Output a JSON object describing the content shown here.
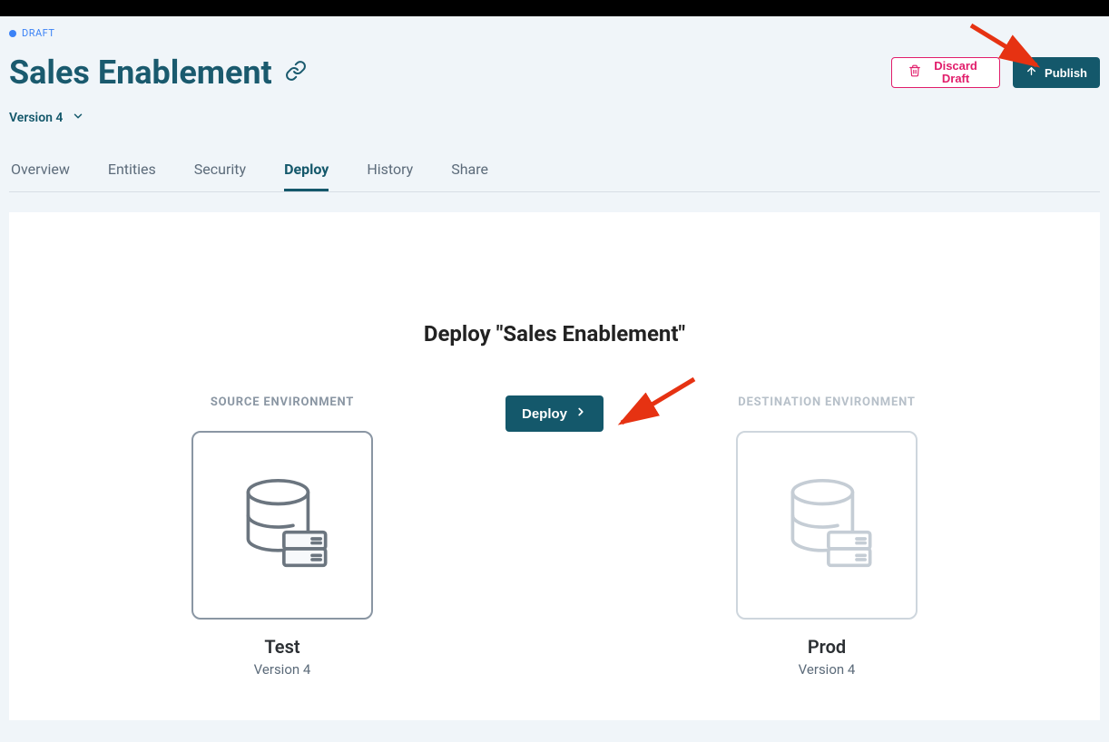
{
  "status": "DRAFT",
  "page_title": "Sales Enablement",
  "version_label": "Version 4",
  "actions": {
    "discard": "Discard Draft",
    "publish": "Publish"
  },
  "tabs": [
    {
      "label": "Overview"
    },
    {
      "label": "Entities"
    },
    {
      "label": "Security"
    },
    {
      "label": "Deploy"
    },
    {
      "label": "History"
    },
    {
      "label": "Share"
    }
  ],
  "active_tab": "Deploy",
  "deploy": {
    "heading": "Deploy \"Sales Enablement\"",
    "deploy_button": "Deploy",
    "source": {
      "label": "SOURCE ENVIRONMENT",
      "name": "Test",
      "version": "Version 4"
    },
    "destination": {
      "label": "DESTINATION ENVIRONMENT",
      "name": "Prod",
      "version": "Version 4"
    }
  }
}
